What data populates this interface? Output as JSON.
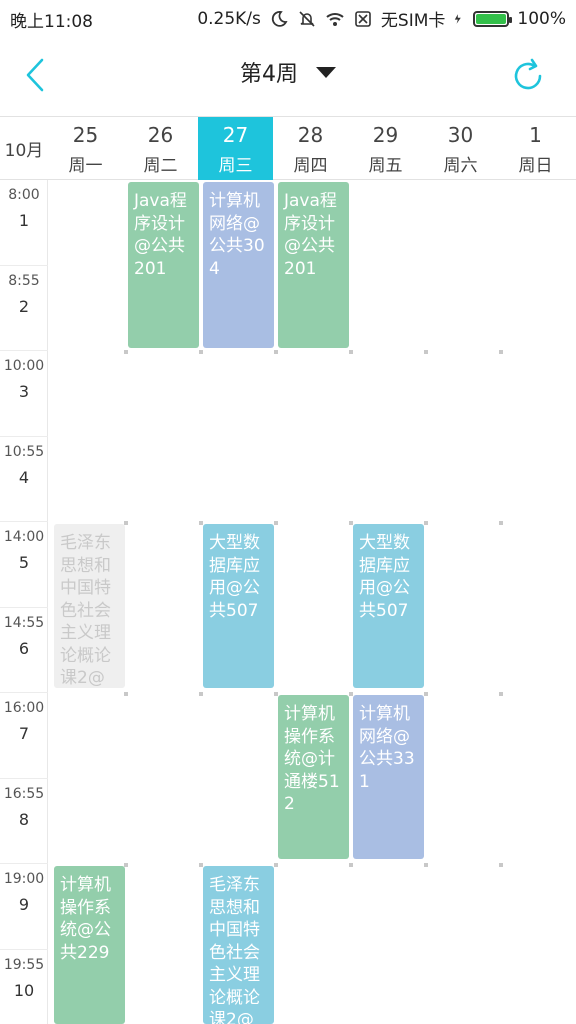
{
  "status_bar": {
    "time": "晚上11:08",
    "speed": "0.25K/s",
    "sim": "无SIM卡",
    "battery": "100%"
  },
  "toolbar": {
    "title": "第4周"
  },
  "header": {
    "month": "10月",
    "days": [
      {
        "date": "25",
        "weekday": "周一"
      },
      {
        "date": "26",
        "weekday": "周二"
      },
      {
        "date": "27",
        "weekday": "周三"
      },
      {
        "date": "28",
        "weekday": "周四"
      },
      {
        "date": "29",
        "weekday": "周五"
      },
      {
        "date": "30",
        "weekday": "周六"
      },
      {
        "date": "1",
        "weekday": "周日"
      }
    ]
  },
  "slots": [
    {
      "time": "8:00",
      "num": "1"
    },
    {
      "time": "8:55",
      "num": "2"
    },
    {
      "time": "10:00",
      "num": "3"
    },
    {
      "time": "10:55",
      "num": "4"
    },
    {
      "time": "14:00",
      "num": "5"
    },
    {
      "time": "14:55",
      "num": "6"
    },
    {
      "time": "16:00",
      "num": "7"
    },
    {
      "time": "16:55",
      "num": "8"
    },
    {
      "time": "19:00",
      "num": "9"
    },
    {
      "time": "19:55",
      "num": "10"
    }
  ],
  "courses": [
    {
      "text": "Java程序设计@公共201"
    },
    {
      "text": "计算机网络@公共304"
    },
    {
      "text": "Java程序设计@公共201"
    },
    {
      "text": "毛泽东思想和中国特色社会主义理论概论课2@"
    },
    {
      "text": "大型数据库应用@公共507"
    },
    {
      "text": "大型数据库应用@公共507"
    },
    {
      "text": "计算机操作系统@计通楼512"
    },
    {
      "text": "计算机网络@公共331"
    },
    {
      "text": "计算机操作系统@公共229"
    },
    {
      "text": "毛泽东思想和中国特色社会主义理论概论课2@"
    }
  ],
  "colors": {
    "accent": "#1ec4dc",
    "green": "#93ceab",
    "purple": "#a9bee3",
    "cyan": "#8acee1",
    "gray": "#efefef"
  }
}
